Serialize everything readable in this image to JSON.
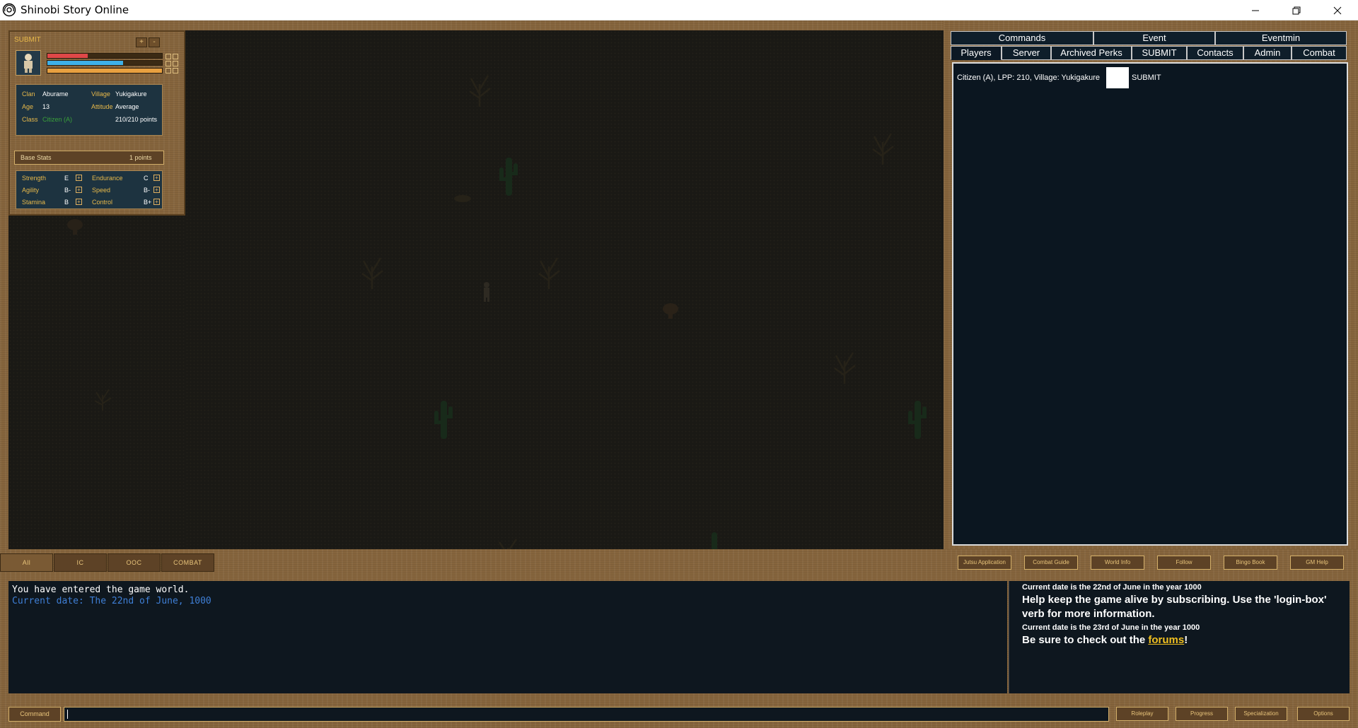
{
  "window": {
    "title": "Shinobi Story Online",
    "controls": [
      "minimize-icon",
      "restore-icon",
      "close-icon"
    ]
  },
  "stats_panel": {
    "header": "SUBMIT",
    "mini_buttons": [
      "+",
      "-"
    ],
    "bars": [
      {
        "name": "health",
        "color": "#e04848",
        "fill": 0.35
      },
      {
        "name": "chakra",
        "color": "#3fb0e8",
        "fill": 0.66
      },
      {
        "name": "stamina",
        "color": "#e8a040",
        "fill": 1.0
      }
    ],
    "info": {
      "clan_label": "Clan",
      "clan": "Aburame",
      "village_label": "Village",
      "village": "Yukigakure",
      "age_label": "Age",
      "age": "13",
      "attitude_label": "Attitude",
      "attitude": "Average",
      "class_label": "Class",
      "class": "Citizen (A)",
      "class_color": "#3aa03a",
      "points": "210/210 points"
    },
    "base_stats": {
      "label": "Base Stats",
      "points": "1 points"
    },
    "stats": [
      {
        "label": "Strength",
        "grade": "E"
      },
      {
        "label": "Endurance",
        "grade": "C"
      },
      {
        "label": "Agility",
        "grade": "B-"
      },
      {
        "label": "Speed",
        "grade": "B-"
      },
      {
        "label": "Stamina",
        "grade": "B"
      },
      {
        "label": "Control",
        "grade": "B+"
      }
    ]
  },
  "right_panel": {
    "tabs_top": [
      "Commands",
      "Event",
      "Eventmin"
    ],
    "tabs_bottom": [
      "Players",
      "Server",
      "Archived Perks",
      "SUBMIT",
      "Contacts",
      "Admin",
      "Combat"
    ],
    "active_tab": "Players",
    "player_row": {
      "text": "Citizen (A), LPP: 210, Village: Yukigakure",
      "action": "SUBMIT"
    }
  },
  "chat_tabs": [
    "All",
    "IC",
    "OOC",
    "COMBAT"
  ],
  "quick_buttons": [
    "Jutsu Application",
    "Combat Guide",
    "World Info",
    "Follow",
    "Bingo Book",
    "GM Help"
  ],
  "chat": {
    "lines": [
      "You have entered the game world.",
      "Current date: The 22nd of June, 1000"
    ]
  },
  "news": {
    "date1": "Current date is the 22nd of June in the year 1000",
    "msg1": "Help keep the game alive by subscribing. Use the 'login-box' verb for more information.",
    "date2": "Current date is the 23rd of June in the year 1000",
    "msg2_prefix": "Be sure to check out the ",
    "msg2_link": "forums",
    "msg2_suffix": "!"
  },
  "command_bar": {
    "label": "Command",
    "value": "",
    "buttons": [
      "Roleplay",
      "Progress",
      "Specialization",
      "Options"
    ]
  }
}
